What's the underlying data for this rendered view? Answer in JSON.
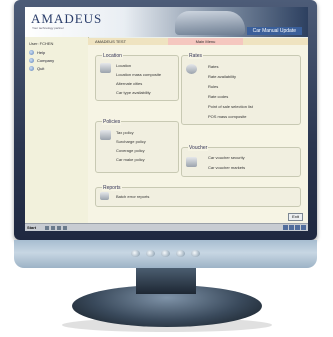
{
  "header": {
    "brand": "AMADEUS",
    "tagline": "Your technology partner",
    "window_title": "Car Manual Update"
  },
  "sidebar": {
    "user_label": "User: FCHEN",
    "items": [
      {
        "label": "Help"
      },
      {
        "label": "Company"
      },
      {
        "label": "Quit"
      }
    ]
  },
  "tabs": {
    "left_label": "AMADEUS TEST",
    "active_label": "Main Menu"
  },
  "sections": {
    "location": {
      "title": "Location",
      "items": [
        "Location",
        "Location mass composite",
        "Alternate cities",
        "Car type availability"
      ]
    },
    "rates": {
      "title": "Rates",
      "items": [
        "Rates",
        "Rate availability",
        "Rules",
        "Rate codes",
        "Point of sale selection list",
        "POS mass composite"
      ]
    },
    "policies": {
      "title": "Policies",
      "items": [
        "Tax policy",
        "Surcharge policy",
        "Coverage policy",
        "Car make policy"
      ]
    },
    "voucher": {
      "title": "Voucher",
      "items": [
        "Car voucher security",
        "Car voucher markets"
      ]
    },
    "reports": {
      "title": "Reports",
      "items": [
        "Batch error reports"
      ]
    }
  },
  "footer": {
    "exit_label": "Exit",
    "start_label": "Start"
  },
  "colors": {
    "accent": "#3a5f9a",
    "panel": "#f2f1dc",
    "active_tab": "#f5c7bf"
  }
}
